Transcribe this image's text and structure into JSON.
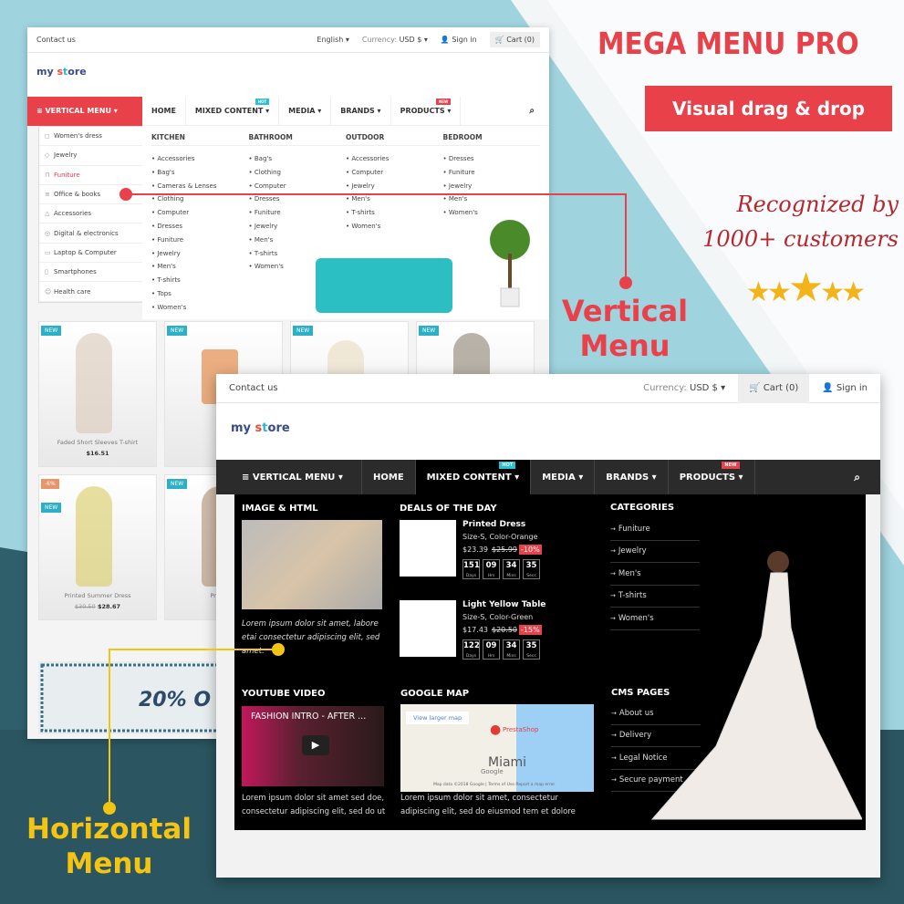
{
  "promo": {
    "title": "MEGA MENU PRO",
    "subtitle_button": "Visual drag & drop",
    "recognized_line1": "Recognized by",
    "recognized_line2": "1000+ customers",
    "stars": 5,
    "vertical_callout_line1": "Vertical",
    "vertical_callout_line2": "Menu",
    "horizontal_callout_line1": "Horizontal",
    "horizontal_callout_line2": "Menu",
    "accent_red": "#e8414a",
    "accent_yellow": "#f4c413"
  },
  "back_shot": {
    "topbar": {
      "contact": "Contact us",
      "language": "English ▾",
      "currency_label": "Currency:",
      "currency": "USD $ ▾",
      "sign_in": "Sign in",
      "cart": "Cart (0)"
    },
    "logo": {
      "my": "my ",
      "s": "s",
      "t": "t",
      "ore": "ore"
    },
    "nav": {
      "vertical": "≡ VERTICAL MENU ▾",
      "items": [
        {
          "label": "HOME"
        },
        {
          "label": "MIXED CONTENT ▾",
          "badge": "HOT"
        },
        {
          "label": "MEDIA ▾"
        },
        {
          "label": "BRANDS ▾"
        },
        {
          "label": "PRODUCTS ▾",
          "badge": "NEW"
        }
      ]
    },
    "vertical_items": [
      "Women's dress",
      "Jewelry",
      "Funiture",
      "Office & books",
      "Accessories",
      "Digital & electronics",
      "Laptop & Computer",
      "Smartphones",
      "Health care"
    ],
    "mega_columns": [
      {
        "title": "KITCHEN",
        "items": [
          "Accessories",
          "Bag's",
          "Cameras & Lenses",
          "Clothing",
          "Computer",
          "Dresses",
          "Funiture",
          "Jewelry",
          "Men's",
          "T-shirts",
          "Tops",
          "Women's"
        ]
      },
      {
        "title": "BATHROOM",
        "items": [
          "Bag's",
          "Clothing",
          "Computer",
          "Dresses",
          "Funiture",
          "Jewelry",
          "Men's",
          "T-shirts",
          "Women's"
        ]
      },
      {
        "title": "OUTDOOR",
        "items": [
          "Accessories",
          "Computer",
          "Jewelry",
          "Men's",
          "T-shirts",
          "Women's"
        ]
      },
      {
        "title": "BEDROOM",
        "items": [
          "Dresses",
          "Funiture",
          "Jewelry",
          "Men's",
          "Women's"
        ]
      }
    ],
    "products": [
      {
        "badge": "NEW",
        "name": "Faded Short Sleeves T-shirt",
        "price": "$16.51"
      },
      {
        "badge": "NEW",
        "name": "",
        "price": ""
      },
      {
        "badge": "NEW",
        "name": "",
        "price": ""
      },
      {
        "badge": "NEW",
        "name": "",
        "price": ""
      },
      {
        "badge": "NEW",
        "discount": "-6%",
        "name": "Printed Summer Dress",
        "old_price": "$30.50",
        "price": "$28.67"
      },
      {
        "badge": "NEW",
        "name": "Printed S",
        "price": ""
      }
    ],
    "banner": "20% O"
  },
  "front_shot": {
    "topbar": {
      "contact": "Contact us",
      "currency_label": "Currency:",
      "currency": "USD $ ▾",
      "cart": "Cart (0)",
      "sign_in": "Sign in"
    },
    "logo": {
      "my": "my ",
      "s": "s",
      "t": "t",
      "ore": "ore"
    },
    "nav": {
      "vertical": "≡ VERTICAL MENU ▾",
      "items": [
        {
          "label": "HOME"
        },
        {
          "label": "MIXED CONTENT ▾",
          "badge": "HOT",
          "active": true
        },
        {
          "label": "MEDIA ▾"
        },
        {
          "label": "BRANDS ▾"
        },
        {
          "label": "PRODUCTS ▾",
          "badge": "NEW"
        }
      ]
    },
    "mega": {
      "image_html": {
        "title": "IMAGE & HTML",
        "text": "Lorem ipsum dolor sit amet, labore etai consectetur adipiscing elit, sed amet."
      },
      "deals": {
        "title": "DEALS OF THE DAY",
        "items": [
          {
            "name": "Printed Dress",
            "variant": "Size-S, Color-Orange",
            "price": "$23.39",
            "old_price": "$25.99",
            "discount": "-10%",
            "countdown": [
              {
                "v": "151",
                "u": "Days"
              },
              {
                "v": "09",
                "u": "Hrs"
              },
              {
                "v": "34",
                "u": "Mins"
              },
              {
                "v": "35",
                "u": "Secs"
              }
            ]
          },
          {
            "name": "Light Yellow Table",
            "variant": "Size-S, Color-Green",
            "price": "$17.43",
            "old_price": "$20.50",
            "discount": "-15%",
            "countdown": [
              {
                "v": "122",
                "u": "Days"
              },
              {
                "v": "09",
                "u": "Hrs"
              },
              {
                "v": "34",
                "u": "Mins"
              },
              {
                "v": "35",
                "u": "Secs"
              }
            ]
          }
        ]
      },
      "categories": {
        "title": "CATEGORIES",
        "items": [
          "Funiture",
          "Jewelry",
          "Men's",
          "T-shirts",
          "Women's"
        ]
      },
      "youtube": {
        "title": "YOUTUBE VIDEO",
        "video_title": "FASHION INTRO - AFTER ...",
        "text": "Lorem ipsum dolor sit amet sed doe, consectetur adipiscing elit, sed do ut"
      },
      "map": {
        "title": "GOOGLE MAP",
        "larger": "View larger map",
        "place": "PrestaShop",
        "city": "Miami",
        "google": "Google",
        "footer": "Map data ©2018 Google | Terms of Use   Report a map error",
        "text": "Lorem ipsum dolor sit amet, consectetur adipiscing elit, sed do eiusmod tem et dolore"
      },
      "cms": {
        "title": "CMS PAGES",
        "items": [
          "About us",
          "Delivery",
          "Legal Notice",
          "Secure payment"
        ]
      }
    }
  }
}
